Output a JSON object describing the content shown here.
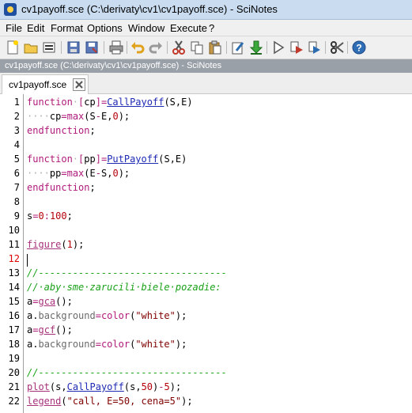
{
  "window": {
    "title": "cv1payoff.sce (C:\\derivaty\\cv1\\cv1payoff.sce) - SciNotes"
  },
  "menu": [
    "File",
    "Edit",
    "Format",
    "Options",
    "Window",
    "Execute",
    "?"
  ],
  "toolbar": {
    "icons": [
      "new-file-icon",
      "open-file-icon",
      "open-recent-icon",
      "save-icon",
      "save-as-icon",
      "print-icon",
      "undo-icon",
      "redo-icon",
      "cut-icon",
      "copy-icon",
      "paste-icon",
      "preferences-icon",
      "load-into-scilab-icon",
      "execute-icon",
      "execute-file-icon",
      "execute-selection-icon",
      "scissors-icon",
      "help-icon"
    ]
  },
  "path": "cv1payoff.sce (C:\\derivaty\\cv1\\cv1payoff.sce) - SciNotes",
  "tab": {
    "label": "cv1payoff.sce"
  },
  "editor": {
    "active_line": 12,
    "line_numbers": [
      "1",
      "2",
      "3",
      "4",
      "5",
      "6",
      "7",
      "8",
      "9",
      "10",
      "11",
      "12",
      "13",
      "14",
      "15",
      "16",
      "17",
      "18",
      "19",
      "20",
      "21",
      "22"
    ],
    "lines": [
      "function [cp]=CallPayoff(S,E)",
      "    cp=max(S-E,0);",
      "endfunction;",
      "",
      "function [pp]=PutPayoff(S,E)",
      "    pp=max(E-S,0);",
      "endfunction;",
      "",
      "s=0:100;",
      "",
      "figure(1);",
      "",
      "//---------------------------------",
      "// aby sme zarucili biele pozadie:",
      "a=gca();",
      "a.background=color(\"white\");",
      "a=gcf();",
      "a.background=color(\"white\");",
      "",
      "//---------------------------------",
      "plot(s,CallPayoff(s,50)-5);",
      "legend(\"call, E=50, cena=5\");"
    ]
  },
  "colors": {
    "keyword": "#b01a7a",
    "function": "#1e2ab4",
    "number": "#b5000b",
    "string": "#800000",
    "comment": "#1aa11a"
  }
}
